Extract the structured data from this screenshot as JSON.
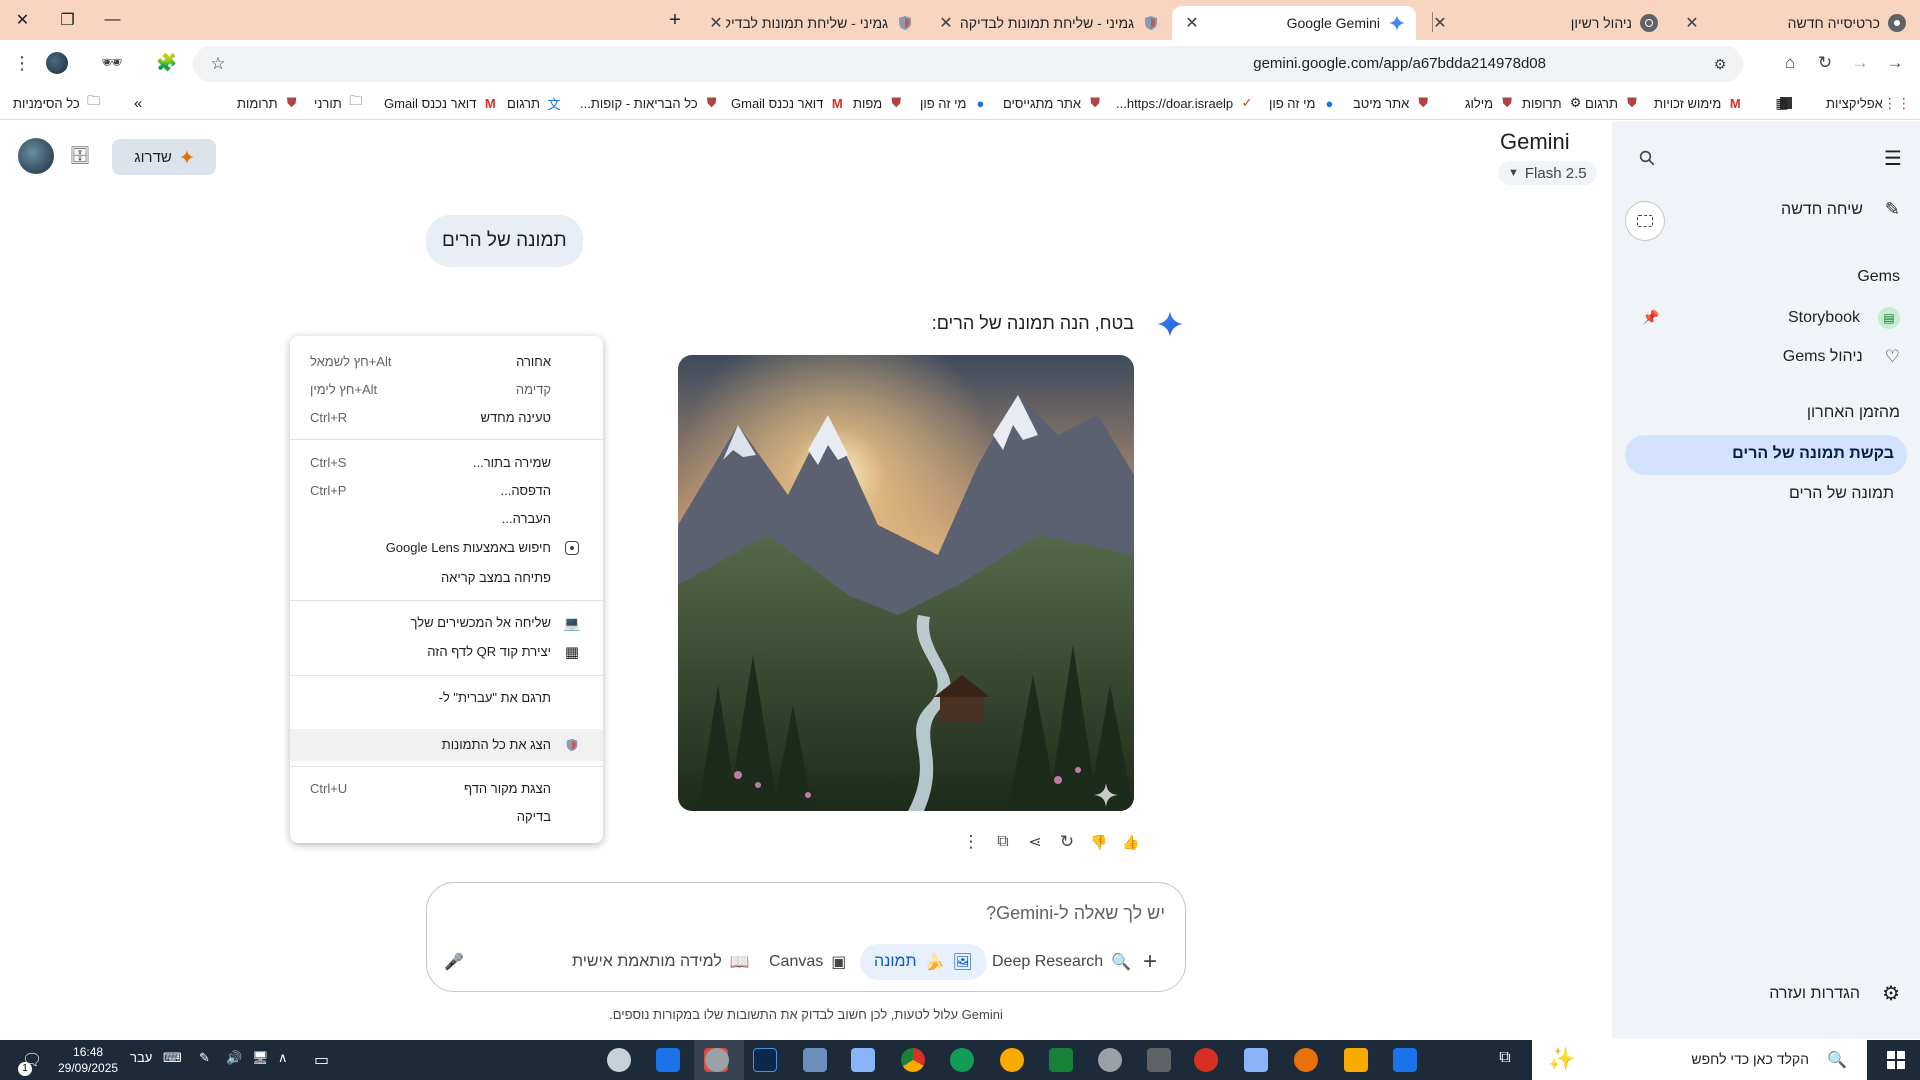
{
  "tabs": [
    {
      "label": "כרטיסייה חדשה",
      "active": false
    },
    {
      "label": "ניהול רשיון",
      "active": false
    },
    {
      "label": "Google Gemini",
      "active": true
    },
    {
      "label": "גמיני - שליחת תמונות לבדיקה",
      "active": false
    },
    {
      "label": "גמיני - שליחת תמונות לבדיקה -",
      "active": false
    }
  ],
  "toolbar": {
    "url": "gemini.google.com/app/a67bdda214978d08"
  },
  "bookmarks": {
    "apps": "אפליקציות",
    "items": [
      "מימוש זכויות",
      "תרגום",
      "תרופות",
      "מילוג",
      "אתר מיטב",
      "מי זה פון",
      "https://doar.israelp...",
      "אתר מתגייסים",
      "מי זה פון",
      "מפות",
      "דואר נכנס Gmail",
      "כל הבריאות - קופות...",
      "תרגום",
      "דואר נכנס Gmail",
      "תורני",
      "תרומות"
    ],
    "all_bookmarks": "כל הסימניות"
  },
  "sidebar": {
    "new_chat": "שיחה חדשה",
    "gems_heading": "Gems",
    "storybook": "Storybook",
    "manage_gems": "ניהול Gems",
    "recent_heading": "מהזמן האחרון",
    "recent": [
      "בקשת תמונה של הרים",
      "תמונה של הרים"
    ],
    "settings": "הגדרות ועזרה"
  },
  "header": {
    "title": "Gemini",
    "model": "2.5 Flash",
    "upgrade": "שדרוג"
  },
  "chat": {
    "user_message": "תמונה של הרים",
    "response_text": "בטח, הנה תמונה של הרים:"
  },
  "input": {
    "placeholder": "יש לך שאלה ל-Gemini?",
    "tools": {
      "deep_research": "Deep Research",
      "image": "תמונה",
      "canvas": "Canvas",
      "guided_learning": "למידה מותאמת אישית"
    },
    "disclaimer": "Gemini עלול לטעות, לכן חשוב לבדוק את התשובות שלו במקורות נוספים."
  },
  "context_menu": {
    "back": {
      "label": "אחורה",
      "shortcut": "Alt+חץ לשמאל"
    },
    "forward": {
      "label": "קדימה",
      "shortcut": "Alt+חץ לימין"
    },
    "reload": {
      "label": "טעינה מחדש",
      "shortcut": "Ctrl+R"
    },
    "save_as": {
      "label": "שמירה בתור...",
      "shortcut": "Ctrl+S"
    },
    "print": {
      "label": "הדפסה...",
      "shortcut": "Ctrl+P"
    },
    "cast": {
      "label": "העברה..."
    },
    "lens": {
      "label": "חיפוש באמצעות Google Lens"
    },
    "reading_mode": {
      "label": "פתיחה במצב קריאה"
    },
    "send_devices": {
      "label": "שליחה אל המכשירים שלך"
    },
    "qr": {
      "label": "יצירת קוד QR לדף הזה"
    },
    "translate": {
      "label": "תרגם את \"עברית\" ל-"
    },
    "show_images": {
      "label": "הצג את כל התמונות"
    },
    "view_source": {
      "label": "הצגת מקור הדף",
      "shortcut": "Ctrl+U"
    },
    "inspect": {
      "label": "בדיקה"
    }
  },
  "taskbar": {
    "search_placeholder": "הקלד כאן כדי לחפש",
    "time": "16:48",
    "date": "29/09/2025",
    "lang": "עבר",
    "notif_count": "1"
  },
  "colors": {
    "tabstrip": "#f7d5c1",
    "sidebar": "#f0f4f9",
    "active_recent": "#d3e3fd",
    "taskbar": "#1c2a3a",
    "accent": "#0b57d0"
  }
}
